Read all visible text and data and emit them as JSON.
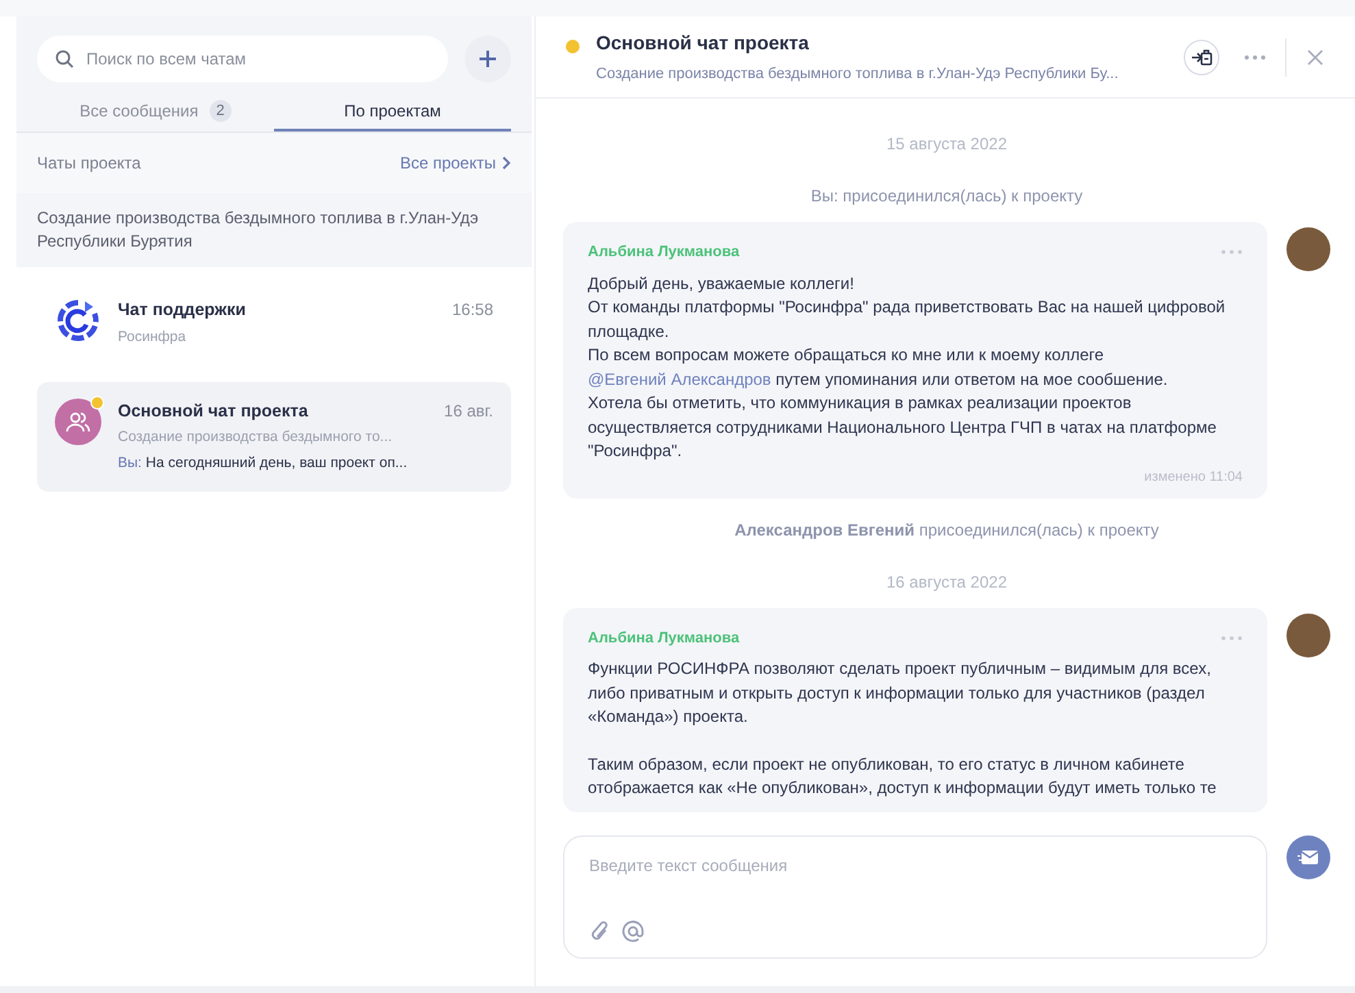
{
  "sidebar": {
    "search": {
      "placeholder": "Поиск по всем чатам"
    },
    "tabs": [
      {
        "label": "Все сообщения",
        "badge": "2",
        "selected": false
      },
      {
        "label": "По проектам",
        "selected": true
      }
    ],
    "section": {
      "title": "Чаты проекта",
      "link": "Все проекты"
    },
    "project": "Создание производства бездымного топлива в г.Улан-Удэ Республики Бурятия",
    "chats": [
      {
        "kind": "support",
        "title": "Чат поддержки",
        "subtitle": "Росинфра",
        "time": "16:58",
        "selected": false
      },
      {
        "kind": "group",
        "title": "Основной чат проекта",
        "subtitle": "Создание производства бездымного то...",
        "preview_author": "Вы:",
        "preview": "На сегодняшний день, ваш проект оп...",
        "time": "16 авг.",
        "starred": true,
        "selected": true
      }
    ]
  },
  "chat": {
    "title": "Основной чат проекта",
    "subtitle": "Создание производства бездымного топлива в г.Улан-Удэ Республики Бу...",
    "starred": true,
    "feed": [
      {
        "kind": "date",
        "text": "15 августа 2022"
      },
      {
        "kind": "event",
        "text": "Вы: присоединился(лась) к проекту"
      },
      {
        "kind": "message",
        "author": "Альбина Лукманова",
        "paragraphs": [
          [
            {
              "kind": "text",
              "text": "Добрый день, уважаемые коллеги!"
            }
          ],
          [
            {
              "kind": "text",
              "text": "От команды платформы \"Росинфра\" рада приветствовать Вас на нашей цифровой площадке."
            }
          ],
          [
            {
              "kind": "text",
              "text": "По всем вопросам можете обращаться ко мне или к моему коллеге "
            },
            {
              "kind": "mention",
              "text": "@Евгений Александров"
            },
            {
              "kind": "text",
              "text": " путем упоминания или ответом на мое сообшение."
            }
          ],
          [
            {
              "kind": "text",
              "text": "Хотела бы отметить, что коммуникация в рамках реализации проектов осуществляется сотрудниками Национального Центра ГЧП в чатах на платформе \"Росинфра\"."
            }
          ]
        ],
        "edited": "изменено 11:04"
      },
      {
        "kind": "event",
        "text": "**Александров Евгений** присоединился(лась) к проекту"
      },
      {
        "kind": "date",
        "text": "16 августа 2022"
      },
      {
        "kind": "message",
        "author": "Альбина Лукманова",
        "paragraphs": [
          [
            {
              "kind": "text",
              "text": "Функции РОСИНФРА позволяют сделать проект публичным – видимым для всех, либо приватным и открыть доступ к информации только для участников (раздел «Команда») проекта."
            }
          ],
          [
            {
              "kind": "text",
              "text": "Таким образом, если проект не опубликован, то его статус в личном кабинете отображается как «Не опубликован», доступ к информации будут иметь только те"
            }
          ]
        ]
      }
    ],
    "composer": {
      "placeholder": "Введите текст сообщения"
    }
  }
}
